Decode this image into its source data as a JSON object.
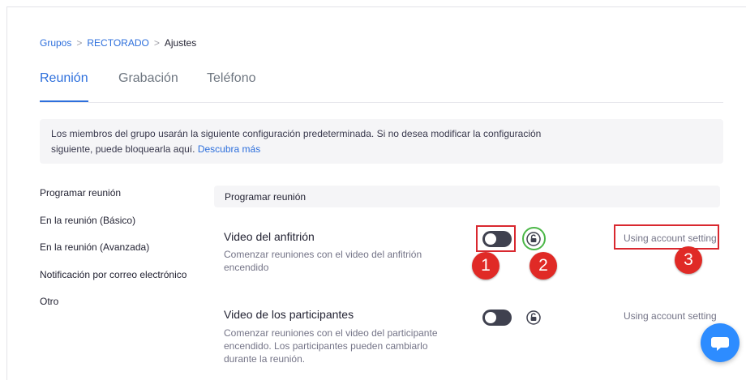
{
  "breadcrumb": {
    "item1": "Grupos",
    "item2": "RECTORADO",
    "item3": "Ajustes",
    "separator": ">"
  },
  "tabs": {
    "reunion": "Reunión",
    "grabacion": "Grabación",
    "telefono": "Teléfono"
  },
  "info": {
    "text": "Los miembros del grupo usarán la siguiente configuración predeterminada. Si no desea modificar la configuración siguiente, puede bloquearla aquí.",
    "link": "Descubra más"
  },
  "sidebar": {
    "items": [
      {
        "label": "Programar reunión"
      },
      {
        "label": "En la reunión (Básico)"
      },
      {
        "label": "En la reunión (Avanzada)"
      },
      {
        "label": "Notificación por correo electrónico"
      },
      {
        "label": "Otro"
      }
    ]
  },
  "section": {
    "title": "Programar reunión"
  },
  "settings": [
    {
      "title": "Video del anfitrión",
      "description": "Comenzar reuniones con el video del anfitrión encendido",
      "status": "Using account setting",
      "toggle_on": false,
      "locked": false
    },
    {
      "title": "Video de los participantes",
      "description": "Comenzar reuniones con el video del participante encendido. Los participantes pueden cambiarlo durante la reunión.",
      "status": "Using account setting",
      "toggle_on": false,
      "locked": false
    }
  ],
  "annotations": {
    "n1": "1",
    "n2": "2",
    "n3": "3"
  },
  "colors": {
    "accent": "#2d6fdc",
    "toggle_off": "#3f414f",
    "annotation_red": "#e02a26",
    "annotation_green": "#4cb748",
    "chat": "#2d8cff"
  },
  "icons": {
    "lock": "unlock-icon",
    "chat": "chat-bubble-icon"
  }
}
